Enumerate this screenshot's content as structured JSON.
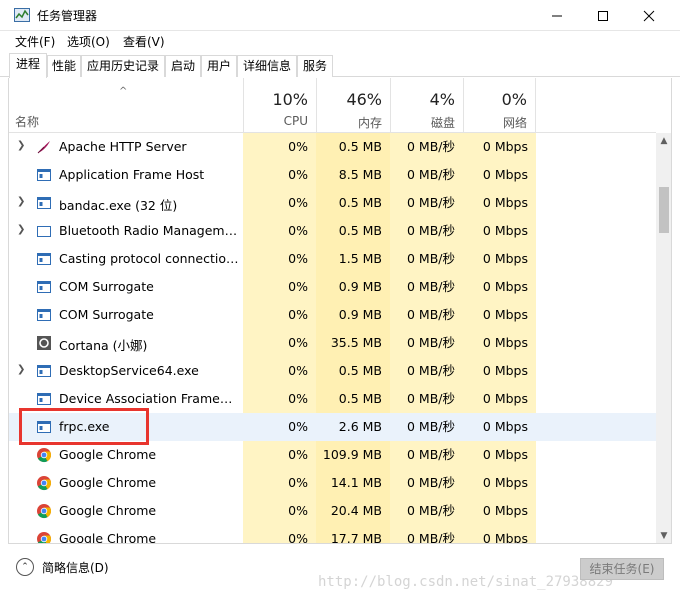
{
  "window": {
    "title": "任务管理器",
    "controls": {
      "minimize": "—",
      "maximize": "☐",
      "close": "✕"
    }
  },
  "menu": [
    {
      "label": "文件(F)"
    },
    {
      "label": "选项(O)"
    },
    {
      "label": "查看(V)"
    }
  ],
  "tabs": [
    {
      "label": "进程",
      "active": true
    },
    {
      "label": "性能"
    },
    {
      "label": "应用历史记录"
    },
    {
      "label": "启动"
    },
    {
      "label": "用户"
    },
    {
      "label": "详细信息"
    },
    {
      "label": "服务"
    }
  ],
  "header": {
    "sort_arrow": "^",
    "name_label": "名称",
    "columns": [
      {
        "pct": "10%",
        "label": "CPU"
      },
      {
        "pct": "46%",
        "label": "内存"
      },
      {
        "pct": "4%",
        "label": "磁盘"
      },
      {
        "pct": "0%",
        "label": "网络"
      }
    ]
  },
  "rows": [
    {
      "expandable": true,
      "icon": "feather-icon",
      "name": "Apache HTTP Server",
      "cpu": "0%",
      "mem": "0.5 MB",
      "disk": "0 MB/秒",
      "net": "0 Mbps"
    },
    {
      "expandable": false,
      "icon": "window-app-icon",
      "name": "Application Frame Host",
      "cpu": "0%",
      "mem": "8.5 MB",
      "disk": "0 MB/秒",
      "net": "0 Mbps"
    },
    {
      "expandable": true,
      "icon": "window-app-icon",
      "name": "bandac.exe (32 位)",
      "cpu": "0%",
      "mem": "0.5 MB",
      "disk": "0 MB/秒",
      "net": "0 Mbps"
    },
    {
      "expandable": true,
      "icon": "window-frame-icon",
      "name": "Bluetooth Radio Manageme...",
      "cpu": "0%",
      "mem": "0.5 MB",
      "disk": "0 MB/秒",
      "net": "0 Mbps"
    },
    {
      "expandable": false,
      "icon": "window-app-icon",
      "name": "Casting protocol connection ...",
      "cpu": "0%",
      "mem": "1.5 MB",
      "disk": "0 MB/秒",
      "net": "0 Mbps"
    },
    {
      "expandable": false,
      "icon": "window-app-icon",
      "name": "COM Surrogate",
      "cpu": "0%",
      "mem": "0.9 MB",
      "disk": "0 MB/秒",
      "net": "0 Mbps"
    },
    {
      "expandable": false,
      "icon": "window-app-icon",
      "name": "COM Surrogate",
      "cpu": "0%",
      "mem": "0.9 MB",
      "disk": "0 MB/秒",
      "net": "0 Mbps"
    },
    {
      "expandable": false,
      "icon": "cortana-icon",
      "name": "Cortana (小娜)",
      "cpu": "0%",
      "mem": "35.5 MB",
      "disk": "0 MB/秒",
      "net": "0 Mbps"
    },
    {
      "expandable": true,
      "icon": "window-app-icon",
      "name": "DesktopService64.exe",
      "cpu": "0%",
      "mem": "0.5 MB",
      "disk": "0 MB/秒",
      "net": "0 Mbps"
    },
    {
      "expandable": false,
      "icon": "window-app-icon",
      "name": "Device Association Framewo...",
      "cpu": "0%",
      "mem": "0.5 MB",
      "disk": "0 MB/秒",
      "net": "0 Mbps"
    },
    {
      "expandable": false,
      "icon": "window-app-icon",
      "name": "frpc.exe",
      "cpu": "0%",
      "mem": "2.6 MB",
      "disk": "0 MB/秒",
      "net": "0 Mbps",
      "selected": true
    },
    {
      "expandable": false,
      "icon": "chrome-icon",
      "name": "Google Chrome",
      "cpu": "0%",
      "mem": "109.9 MB",
      "disk": "0 MB/秒",
      "net": "0 Mbps"
    },
    {
      "expandable": false,
      "icon": "chrome-icon",
      "name": "Google Chrome",
      "cpu": "0%",
      "mem": "14.1 MB",
      "disk": "0 MB/秒",
      "net": "0 Mbps"
    },
    {
      "expandable": false,
      "icon": "chrome-icon",
      "name": "Google Chrome",
      "cpu": "0%",
      "mem": "20.4 MB",
      "disk": "0 MB/秒",
      "net": "0 Mbps"
    },
    {
      "expandable": false,
      "icon": "chrome-icon",
      "name": "Google Chrome",
      "cpu": "0%",
      "mem": "17.7 MB",
      "disk": "0 MB/秒",
      "net": "0 Mbps"
    }
  ],
  "footer": {
    "fewer_details": "简略信息(D)",
    "end_task": "结束任务(E)",
    "watermark": "http://blog.csdn.net/sinat_27938829"
  },
  "colors": {
    "highlight_box": "#e8352e",
    "heat_fill": "#fff4c4",
    "selected_row": "#eaf2fb"
  }
}
